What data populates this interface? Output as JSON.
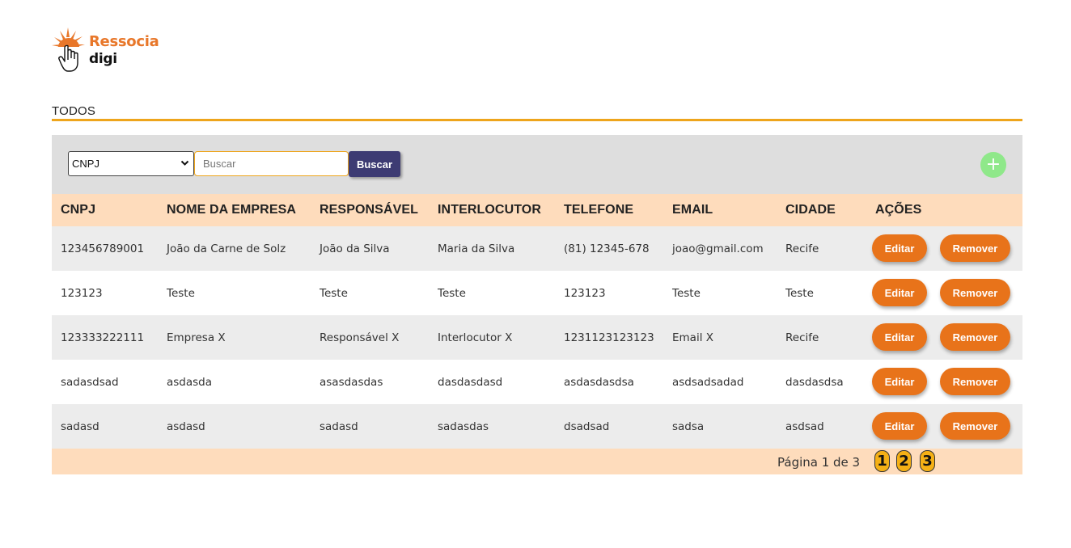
{
  "brand": {
    "line1": "Ressocia",
    "line2": "digi",
    "accent_color": "#e8772a"
  },
  "section": {
    "title": "TODOS",
    "rule_color": "#eea51c"
  },
  "toolbar": {
    "filter_selected": "CNPJ",
    "search_placeholder": "Buscar",
    "search_value": "",
    "search_button_label": "Buscar",
    "add_button_label": "+",
    "add_icon": "plus-icon"
  },
  "table": {
    "columns": [
      "CNPJ",
      "NOME DA EMPRESA",
      "RESPONSÁVEL",
      "INTERLOCUTOR",
      "TELEFONE",
      "EMAIL",
      "CIDADE",
      "AÇÕES"
    ],
    "rows": [
      [
        "123456789001",
        "João da Carne de Solz",
        "João da Silva",
        "Maria da Silva",
        "(81) 12345-678",
        "joao@gmail.com",
        "Recife"
      ],
      [
        "123123",
        "Teste",
        "Teste",
        "Teste",
        "123123",
        "Teste",
        "Teste"
      ],
      [
        "123333222111",
        "Empresa X",
        "Responsável X",
        "Interlocutor X",
        "1231123123123",
        "Email X",
        "Recife"
      ],
      [
        "sadasdsad",
        "asdasda",
        "asasdasdas",
        "dasdasdasd",
        "asdasdasdsa",
        "asdsadsadad",
        "dasdasdsa"
      ],
      [
        "sadasd",
        "asdasd",
        "sadasd",
        "sadasdas",
        "dsadsad",
        "sadsa",
        "asdsad"
      ]
    ],
    "edit_label": "Editar",
    "remove_label": "Remover",
    "action_color": "#e8731a",
    "header_bg": "#fedcbc"
  },
  "pagination": {
    "label": "Página 1 de 3",
    "pages": [
      "1",
      "2",
      "3"
    ],
    "page_color": "#f5b015"
  }
}
